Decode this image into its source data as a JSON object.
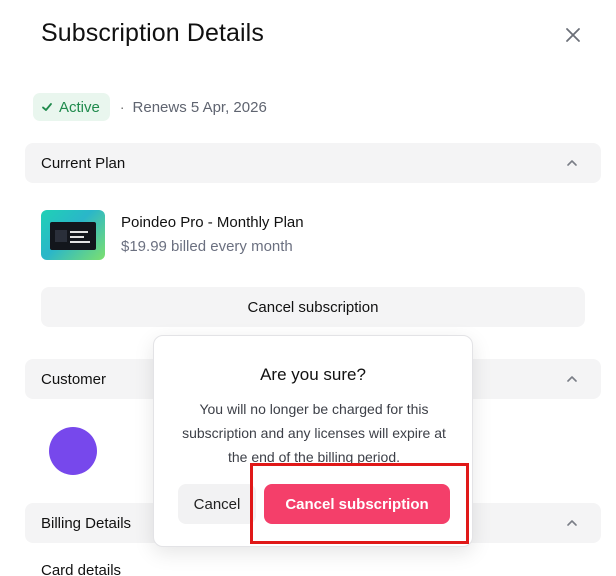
{
  "header": {
    "title": "Subscription Details",
    "close_icon": "close-icon"
  },
  "status": {
    "badge_label": "Active",
    "separator": "·",
    "renews_text": "Renews 5 Apr, 2026",
    "badge_color": "#1f8a4c",
    "badge_bg": "#e9f6ee"
  },
  "sections": {
    "current_plan": {
      "label": "Current Plan"
    },
    "customer": {
      "label": "Customer"
    },
    "billing": {
      "label": "Billing Details"
    }
  },
  "plan": {
    "name": "Poindeo Pro - Monthly Plan",
    "price": "$19.99 billed every month",
    "cancel_label": "Cancel subscription"
  },
  "customer": {
    "avatar_color": "#7748ec"
  },
  "billing": {
    "card_details_label": "Card details"
  },
  "modal": {
    "title": "Are you sure?",
    "body": "You will no longer be charged for this subscription and any licenses will expire at the end of the billing period.",
    "cancel_label": "Cancel",
    "confirm_label": "Cancel subscription",
    "confirm_color": "#f43f6a"
  },
  "annotation": {
    "highlight_color": "#e01818"
  }
}
